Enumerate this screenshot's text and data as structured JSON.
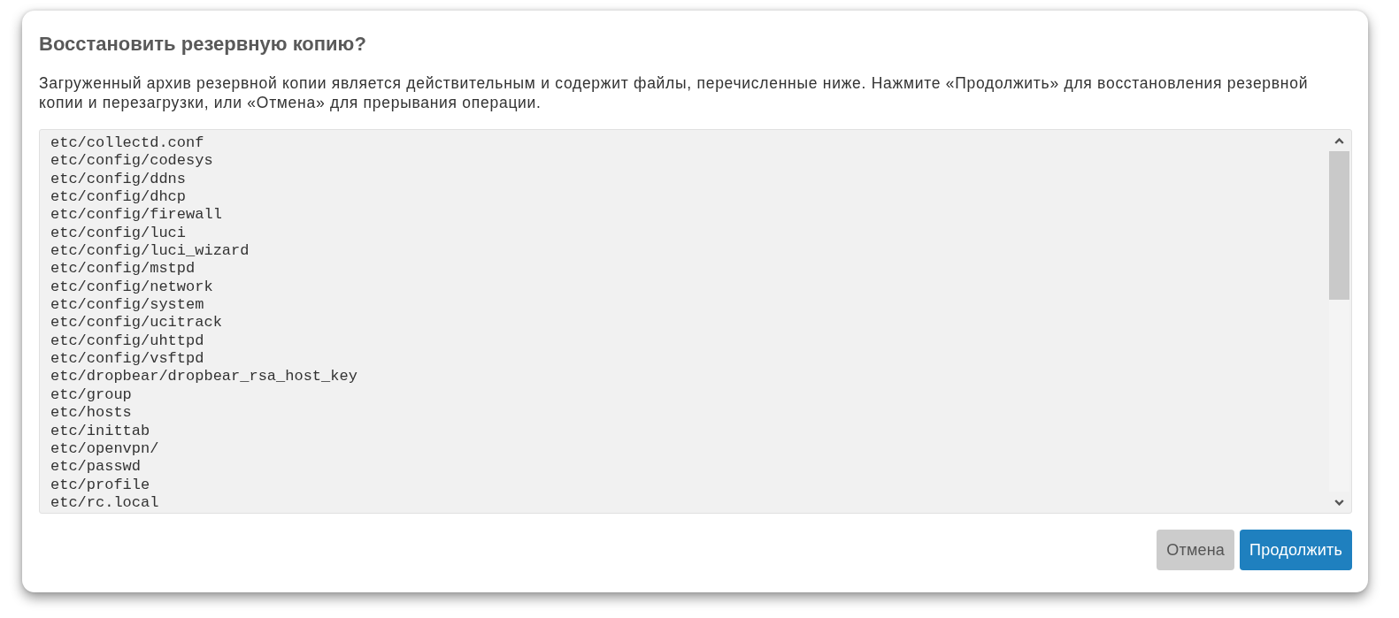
{
  "dialog": {
    "title": "Восстановить резервную копию?",
    "message": "Загруженный архив резервной копии является действительным и содержит файлы, перечисленные ниже. Нажмите «Продолжить» для восстановления резервной копии и перезагрузки, или «Отмена» для прерывания операции.",
    "file_list": [
      "etc/collectd.conf",
      "etc/config/codesys",
      "etc/config/ddns",
      "etc/config/dhcp",
      "etc/config/firewall",
      "etc/config/luci",
      "etc/config/luci_wizard",
      "etc/config/mstpd",
      "etc/config/network",
      "etc/config/system",
      "etc/config/ucitrack",
      "etc/config/uhttpd",
      "etc/config/vsftpd",
      "etc/dropbear/dropbear_rsa_host_key",
      "etc/group",
      "etc/hosts",
      "etc/inittab",
      "etc/openvpn/",
      "etc/passwd",
      "etc/profile",
      "etc/rc.local"
    ],
    "buttons": [
      {
        "label": "Отмена",
        "kind": "secondary"
      },
      {
        "label": "Продолжить",
        "kind": "primary"
      }
    ]
  }
}
